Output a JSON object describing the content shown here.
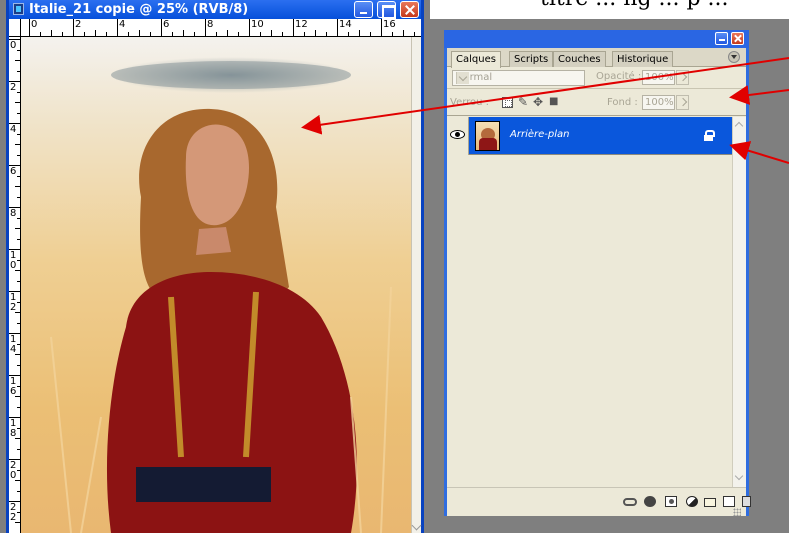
{
  "document_window": {
    "title": "Italie_21 copie @ 25% (RVB/8)",
    "ruler_h_numbers": [
      "0",
      "2",
      "4",
      "6",
      "8",
      "10",
      "12",
      "14",
      "16"
    ],
    "ruler_v_numbers": [
      "0",
      "2",
      "4",
      "6",
      "8",
      "1\n0",
      "1\n2",
      "1\n4",
      "1\n6",
      "1\n8",
      "2\n0",
      "2\n2"
    ]
  },
  "page_heading_partial": "titre ... ng ... p ...",
  "layers_panel": {
    "tabs": [
      "Calques",
      "Scripts",
      "Couches",
      "Historique"
    ],
    "active_tab": "Calques",
    "blend_mode": "Normal",
    "opacity_label": "Opacité :",
    "opacity_value": "100%",
    "lock_label": "Verrou :",
    "fill_label": "Fond :",
    "fill_value": "100%",
    "layers": [
      {
        "name": "Arrière-plan",
        "visible": true,
        "locked": true,
        "selected": true
      }
    ]
  },
  "colors": {
    "workspace_gray": "#7f7f7f",
    "title_bar_blue": "#0650da",
    "selected_layer_blue": "#0a57dc",
    "panel_bg": "#ece9d8",
    "annotation_arrow": "#e00000"
  }
}
